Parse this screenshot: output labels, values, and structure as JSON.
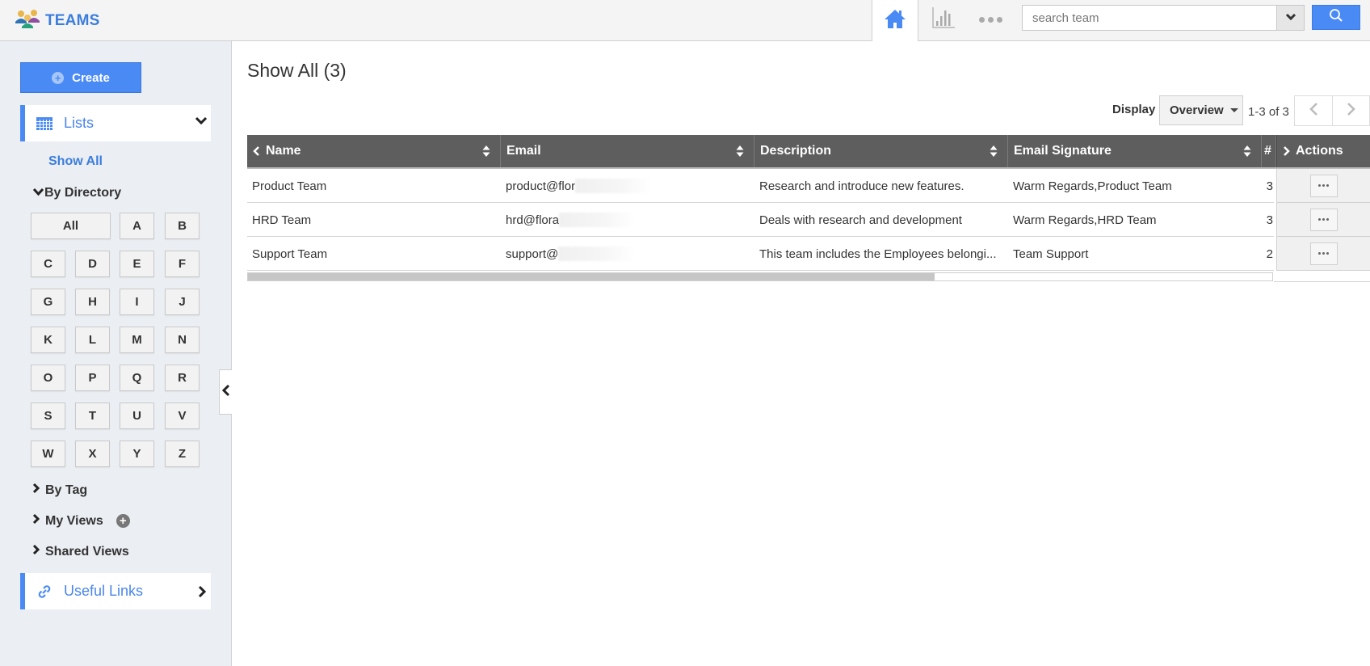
{
  "header": {
    "app_title": "TEAMS",
    "search_placeholder": "search team",
    "search_value": ""
  },
  "sidebar": {
    "create_label": "Create",
    "lists_label": "Lists",
    "show_all_label": "Show All",
    "by_directory_label": "By Directory",
    "letters": [
      "All",
      "A",
      "B",
      "C",
      "D",
      "E",
      "F",
      "G",
      "H",
      "I",
      "J",
      "K",
      "L",
      "M",
      "N",
      "O",
      "P",
      "Q",
      "R",
      "S",
      "T",
      "U",
      "V",
      "W",
      "X",
      "Y",
      "Z"
    ],
    "by_tag_label": "By Tag",
    "my_views_label": "My Views",
    "shared_views_label": "Shared Views",
    "useful_links_label": "Useful Links"
  },
  "main": {
    "page_title": "Show All (3)",
    "display_label": "Display",
    "display_value": "Overview",
    "page_count": "1-3 of 3",
    "scroll_fraction": 0.67,
    "columns": [
      "Name",
      "Email",
      "Description",
      "Email Signature",
      "#",
      "Actions"
    ],
    "rows": [
      {
        "name": "Product Team",
        "email": "product@flor",
        "description": "Research and introduce new features.",
        "signature": "Warm Regards,Product Team",
        "count": "3"
      },
      {
        "name": "HRD Team",
        "email": "hrd@flora",
        "description": "Deals with research and development",
        "signature": "Warm Regards,HRD Team",
        "count": "3"
      },
      {
        "name": "Support Team",
        "email": "support@",
        "description": "This team includes the Employees belongi...",
        "signature": "Team Support",
        "count": "2"
      }
    ]
  },
  "colors": {
    "accent": "#4a8af4",
    "brand_text": "#3b7ddd",
    "table_header": "#5e5e5e",
    "sidebar_bg": "#ebeef3"
  }
}
